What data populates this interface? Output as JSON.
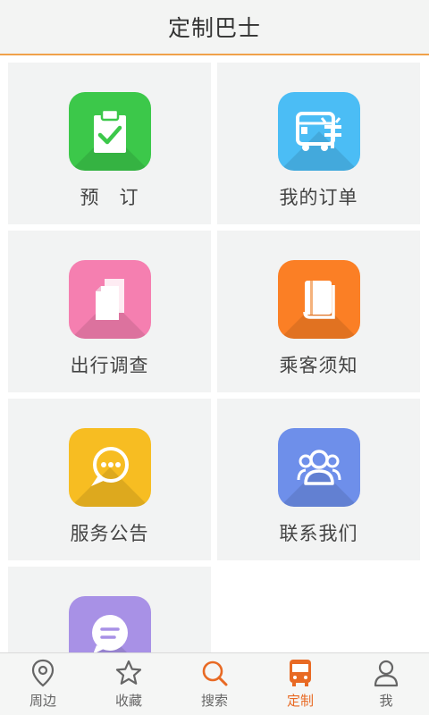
{
  "header": {
    "title": "定制巴士"
  },
  "tiles": [
    {
      "label": "预　订",
      "color": "#3cc84a",
      "icon": "clipboard-check-icon"
    },
    {
      "label": "我的订单",
      "color": "#4bbdf5",
      "icon": "bus-order-icon"
    },
    {
      "label": "出行调查",
      "color": "#f57fb0",
      "icon": "documents-icon"
    },
    {
      "label": "乘客须知",
      "color": "#fb7f25",
      "icon": "book-icon"
    },
    {
      "label": "服务公告",
      "color": "#f7bd22",
      "icon": "speech-bubble-icon"
    },
    {
      "label": "联系我们",
      "color": "#6e8fea",
      "icon": "people-icon"
    },
    {
      "label": "",
      "color": "#a891e6",
      "icon": "message-icon"
    }
  ],
  "bottom_nav": [
    {
      "label": "周边",
      "icon": "location-pin-icon",
      "active": false
    },
    {
      "label": "收藏",
      "icon": "star-icon",
      "active": false
    },
    {
      "label": "搜索",
      "icon": "search-icon",
      "active": false
    },
    {
      "label": "定制",
      "icon": "bus-icon",
      "active": true
    },
    {
      "label": "我",
      "icon": "person-icon",
      "active": false
    }
  ],
  "colors": {
    "accent": "#e86a24",
    "header_border": "#f0a14a",
    "tile_bg": "#f2f3f3"
  }
}
